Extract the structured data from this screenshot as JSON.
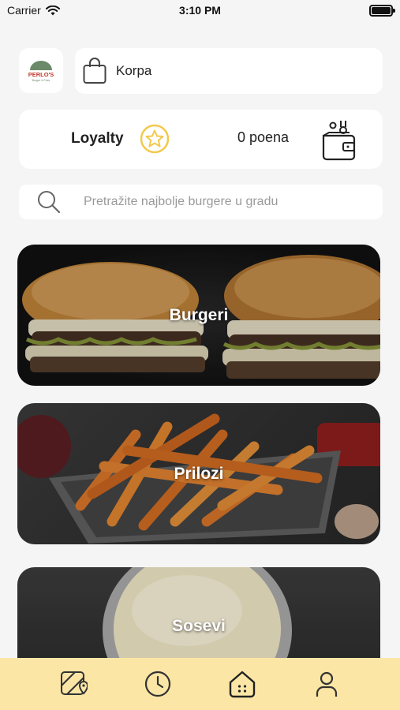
{
  "status_bar": {
    "carrier": "Carrier",
    "time": "3:10 PM"
  },
  "header": {
    "logo_text": "PERLO'S",
    "logo_subtext": "Burger & Fries",
    "cart_label": "Korpa"
  },
  "loyalty": {
    "label": "Loyalty",
    "points": "0 poena"
  },
  "search": {
    "placeholder": "Pretražite najbolje burgere u gradu"
  },
  "categories": [
    {
      "label": "Burgeri"
    },
    {
      "label": "Prilozi"
    },
    {
      "label": "Sosevi"
    }
  ],
  "tab_bar": {
    "tabs": [
      {
        "icon": "map-icon"
      },
      {
        "icon": "clock-icon"
      },
      {
        "icon": "home-icon",
        "active": true
      },
      {
        "icon": "profile-icon"
      }
    ]
  },
  "colors": {
    "background": "#f5f5f5",
    "tab_bar": "#fbe6a6",
    "accent_yellow": "#f2c94c",
    "logo_green": "#6b8a6a",
    "logo_red": "#c0392b"
  }
}
